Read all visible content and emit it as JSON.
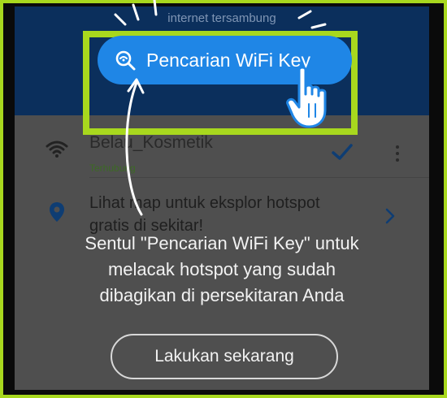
{
  "header": {
    "status_text": "internet tersambung"
  },
  "network": {
    "name": "Belau_Kosmetik",
    "status": "Terhubung"
  },
  "map_promo": {
    "text": "Lihat map untuk eksplor hotspot gratis di sekitar!"
  },
  "search_button": {
    "label": "Pencarian WiFi Key"
  },
  "tooltip": {
    "lines": [
      "Sentul \"Pencarian WiFi Key\" untuk",
      "melacak hotspot yang sudah",
      "dibagikan di persekitaran Anda"
    ]
  },
  "action_button": {
    "label": "Lakukan sekarang"
  },
  "colors": {
    "accent_blue": "#1f86e6",
    "highlight_green": "#a8d81e",
    "header_navy": "#0b2f5c",
    "connected_green": "#3c6a24"
  },
  "icons": [
    "wifi-icon",
    "check-icon",
    "more-icon",
    "location-pin-icon",
    "chevron-right-icon",
    "search-icon",
    "hand-pointer-icon"
  ]
}
